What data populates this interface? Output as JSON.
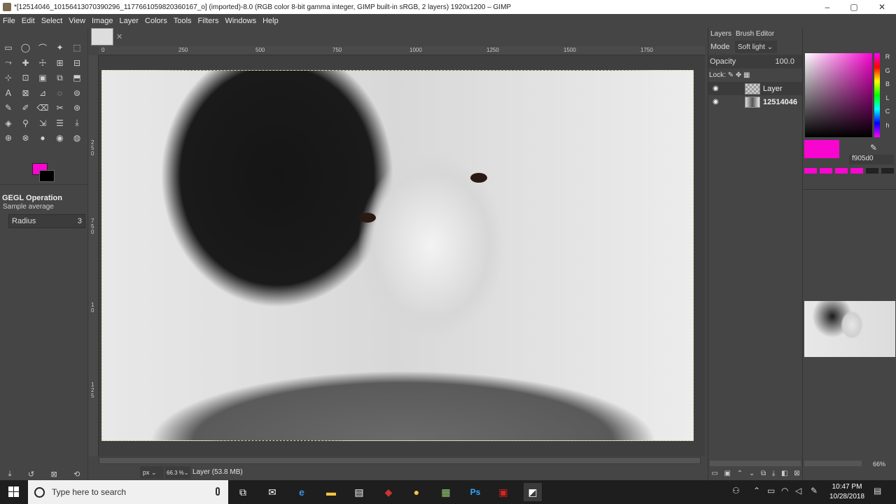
{
  "window": {
    "title": "*[12514046_10156413070390296_1177661059820360167_o] (imported)-8.0 (RGB color 8-bit gamma integer, GIMP built-in sRGB, 2 layers) 1920x1200 – GIMP",
    "minimize_icon": "–",
    "maximize_icon": "▢",
    "close_icon": "✕"
  },
  "menu": [
    "File",
    "Edit",
    "Select",
    "View",
    "Image",
    "Layer",
    "Colors",
    "Tools",
    "Filters",
    "Windows",
    "Help"
  ],
  "rulers": {
    "h_ticks": [
      "0",
      "250",
      "500",
      "750",
      "1000",
      "1250",
      "1500",
      "1750"
    ],
    "v_ticks": [
      "2",
      "5",
      "0",
      "7",
      "5",
      "0",
      "1",
      "0",
      "1",
      "2",
      "5"
    ]
  },
  "tool_options": {
    "title": "GEGL Operation",
    "sample_label": "Sample average",
    "radius_label": "Radius",
    "radius_value": "3"
  },
  "status": {
    "unit": "px",
    "zoom": "66.3 %",
    "text": "Layer (53.8 MB)"
  },
  "layers_dock": {
    "tab_layers": "Layers",
    "tab_brush": "Brush Editor",
    "mode_label": "Mode",
    "mode_value": "Soft light",
    "opacity_label": "Opacity",
    "opacity_value": "100.0",
    "lock_label": "Lock:",
    "layers": [
      {
        "name": "Layer"
      },
      {
        "name": "12514046"
      }
    ]
  },
  "colors_dock": {
    "channels": [
      "R",
      "G",
      "B",
      "L",
      "C",
      "h"
    ],
    "hex_value": "f905d0",
    "fg_color": "#f905d0",
    "nav_zoom": "66%"
  },
  "taskbar": {
    "search_placeholder": "Type here to search",
    "time": "10:47 PM",
    "date": "10/28/2018"
  }
}
